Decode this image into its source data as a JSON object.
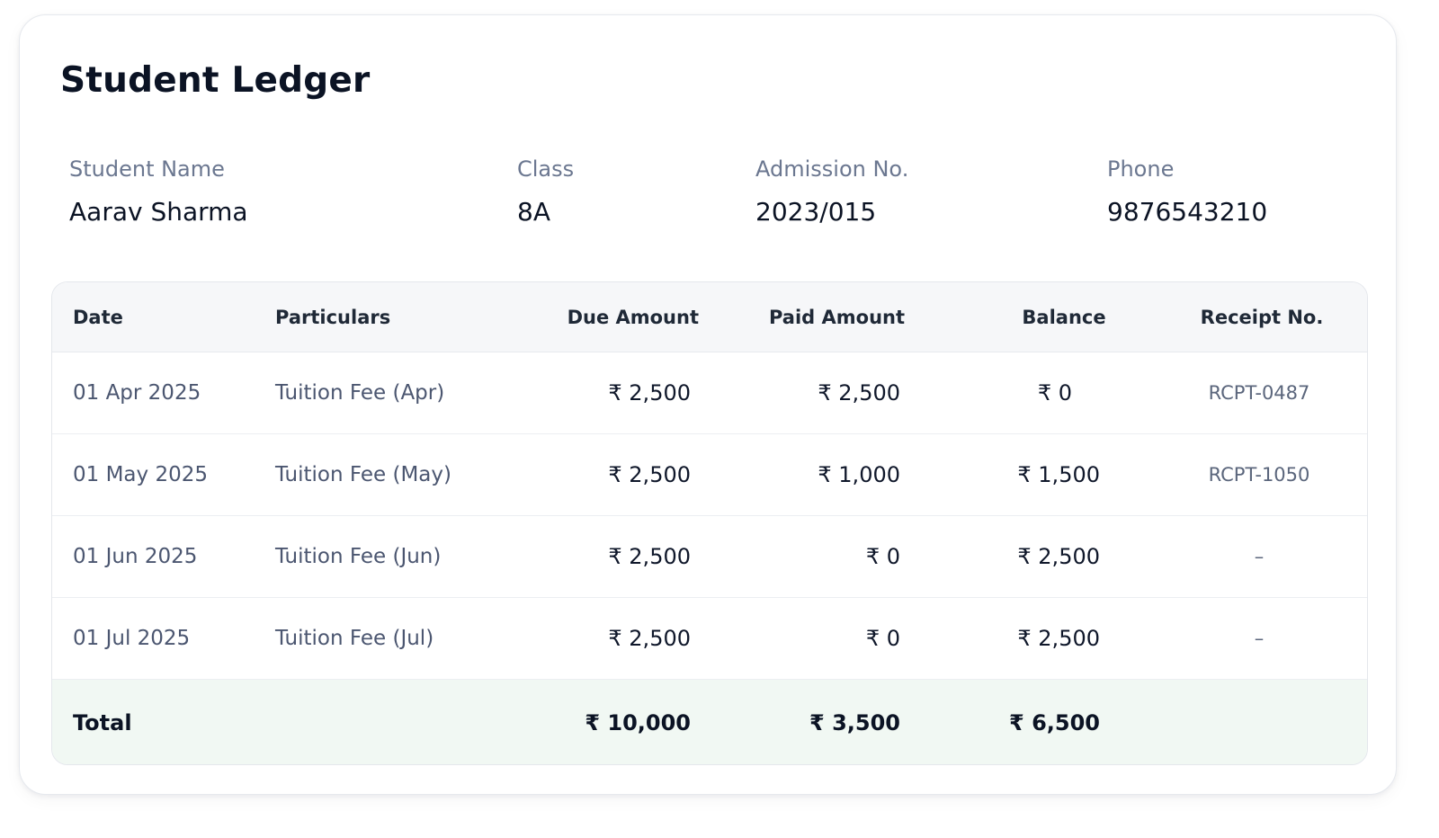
{
  "page": {
    "title": "Student Ledger"
  },
  "student": {
    "name_label": "Student Name",
    "name": "Aarav Sharma",
    "class_label": "Class",
    "class": "8A",
    "admission_label": "Admission No.",
    "admission_no": "2023/015",
    "phone_label": "Phone",
    "phone": "9876543210"
  },
  "table": {
    "headers": {
      "date": "Date",
      "particulars": "Particulars",
      "due": "Due Amount",
      "paid": "Paid Amount",
      "balance": "Balance",
      "receipt": "Receipt No."
    },
    "rows": [
      {
        "date": "01 Apr 2025",
        "particulars": "Tuition Fee (Apr)",
        "due": "₹ 2,500",
        "paid": "₹ 2,500",
        "balance": "₹ 0",
        "receipt": "RCPT-0487"
      },
      {
        "date": "01 May 2025",
        "particulars": "Tuition Fee (May)",
        "due": "₹ 2,500",
        "paid": "₹ 1,000",
        "balance": "₹ 1,500",
        "receipt": "RCPT-1050"
      },
      {
        "date": "01 Jun 2025",
        "particulars": "Tuition Fee (Jun)",
        "due": "₹ 2,500",
        "paid": "₹ 0",
        "balance": "₹ 2,500",
        "receipt": "–"
      },
      {
        "date": "01 Jul 2025",
        "particulars": "Tuition Fee (Jul)",
        "due": "₹ 2,500",
        "paid": "₹ 0",
        "balance": "₹ 2,500",
        "receipt": "–"
      }
    ],
    "total": {
      "label": "Total",
      "due": "₹ 10,000",
      "paid": "₹ 3,500",
      "balance": "₹ 6,500"
    }
  },
  "colors": {
    "header_bg": "#f6f7f9",
    "total_bg": "#f1f8f3",
    "label_text": "#6b7790",
    "primary_text": "#0b1324"
  }
}
